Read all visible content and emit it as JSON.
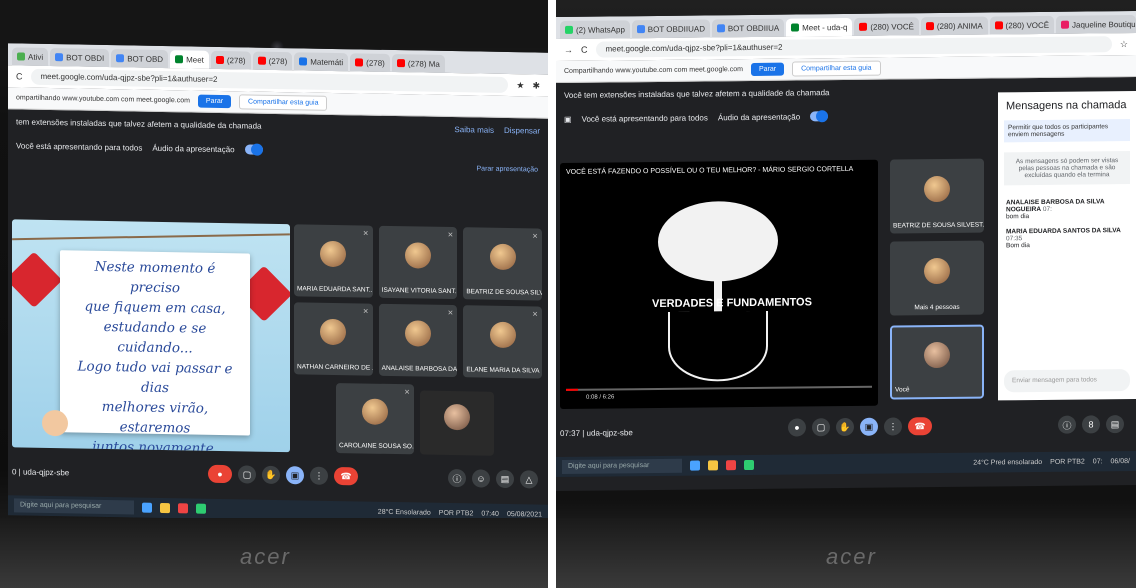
{
  "left": {
    "tabs": [
      "Ativi",
      "BOT OBDI",
      "BOT OBD",
      "Meet",
      "(278)",
      "(278)",
      "Matemáti",
      "(278)",
      "(278) Ma"
    ],
    "url": "meet.google.com/uda-qjpz-sbe?pli=1&authuser=2",
    "share_text": "ompartilhando www.youtube.com com meet.google.com",
    "stop_label": "Parar",
    "switch_label": "Compartilhar esta guia",
    "warning": "tem extensões instaladas que talvez afetem a qualidade da chamada",
    "learn_more": "Saiba mais",
    "dismiss": "Dispensar",
    "presenting": "Você está apresentando para todos",
    "audio": "Áudio da apresentação",
    "stop_presenting": "Parar apresentação",
    "slide_text": [
      "Neste momento é preciso",
      "que fiquem em casa,",
      "estudando e se cuidando...",
      "Logo tudo vai passar e dias",
      "melhores virão, estaremos",
      "juntos novamente."
    ],
    "participants": [
      "MARIA EDUARDA SANT...",
      "ISAYANE VITORIA SANT...",
      "BEATRIZ DE SOUSA SILV...",
      "NATHAN CARNEIRO DE ...",
      "ANALAISE BARBOSA DA ...",
      "ELANE MARIA DA SILVA",
      "CAROLAINE SOUSA SO..."
    ],
    "meet_code": "0 | uda-qjpz-sbe",
    "search": "Digite aqui para pesquisar",
    "weather": "28°C Ensolarado",
    "lang": "POR PTB2",
    "clock": "07:40",
    "date": "05/08/2021",
    "brand": "acer"
  },
  "right": {
    "tabs": [
      "(2) WhatsApp",
      "BOT OBDIIUAD",
      "BOT OBDIIUA",
      "Meet - uda-q",
      "(280) VOCÊ",
      "(280) ANIMA",
      "(280) VOCÊ",
      "Jaqueline Boutiqui"
    ],
    "url": "meet.google.com/uda-qjpz-sbe?pli=1&authuser=2",
    "share_text": "Compartilhando www.youtube.com com meet.google.com",
    "stop_label": "Parar",
    "switch_label": "Compartilhar esta guia",
    "warning": "Você tem extensões instaladas que talvez afetem a qualidade da chamada",
    "presenting": "Você está apresentando para todos",
    "audio": "Áudio da apresentação",
    "video_title": "VOCÊ ESTÁ FAZENDO O POSSÍVEL OU O TEU MELHOR? - MÁRIO SERGIO CORTELLA",
    "video_label": "VERDADES E FUNDAMENTOS",
    "video_time": "0:08 / 6:26",
    "side_tiles": [
      "BEATRIZ DE SOUSA SILVEST...",
      "Mais 4 pessoas",
      "Você"
    ],
    "chat_title": "Mensagens na chamada",
    "chat_option": "Permitir que todos os participantes enviem mensagens",
    "chat_info": "As mensagens só podem ser vistas pelas pessoas na chamada e são excluídas quando ela termina",
    "messages": [
      {
        "who": "ANALAISE BARBOSA DA SILVA NOGUEIRA",
        "time": "07:",
        "text": "bom dia"
      },
      {
        "who": "MARIA EDUARDA SANTOS DA SILVA",
        "time": "07:35",
        "text": "Bom dia"
      }
    ],
    "chat_placeholder": "Enviar mensagem para todos",
    "meet_code": "07:37 | uda-qjpz-sbe",
    "badge": "8",
    "search": "Digite aqui para pesquisar",
    "weather": "24°C Pred ensolarado",
    "lang": "POR PTB2",
    "clock": "07:",
    "date": "06/08/",
    "brand": "acer"
  }
}
